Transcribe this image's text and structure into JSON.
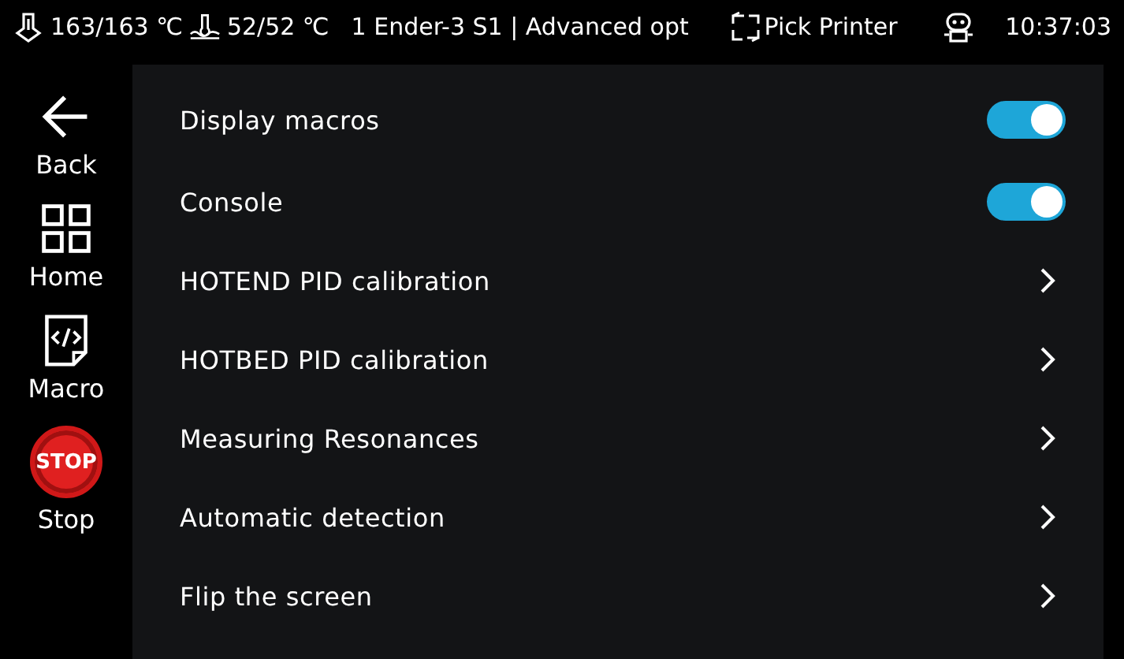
{
  "status_bar": {
    "extruder_temp": "163/163 ℃",
    "bed_temp": "52/52 ℃",
    "title": "1 Ender-3 S1 | Advanced opt",
    "pick_printer": "Pick Printer",
    "time": "10:37:03"
  },
  "sidebar": [
    {
      "kind": "back",
      "label": "Back"
    },
    {
      "kind": "home",
      "label": "Home"
    },
    {
      "kind": "macro",
      "label": "Macro"
    },
    {
      "kind": "stop",
      "label": "Stop",
      "icon_text": "STOP"
    }
  ],
  "settings": [
    {
      "kind": "toggle",
      "label": "Display macros",
      "on": true
    },
    {
      "kind": "toggle",
      "label": "Console",
      "on": true
    },
    {
      "kind": "link",
      "label": "HOTEND PID calibration"
    },
    {
      "kind": "link",
      "label": "HOTBED PID calibration"
    },
    {
      "kind": "link",
      "label": "Measuring Resonances"
    },
    {
      "kind": "link",
      "label": "Automatic detection"
    },
    {
      "kind": "link",
      "label": "Flip the screen"
    }
  ]
}
